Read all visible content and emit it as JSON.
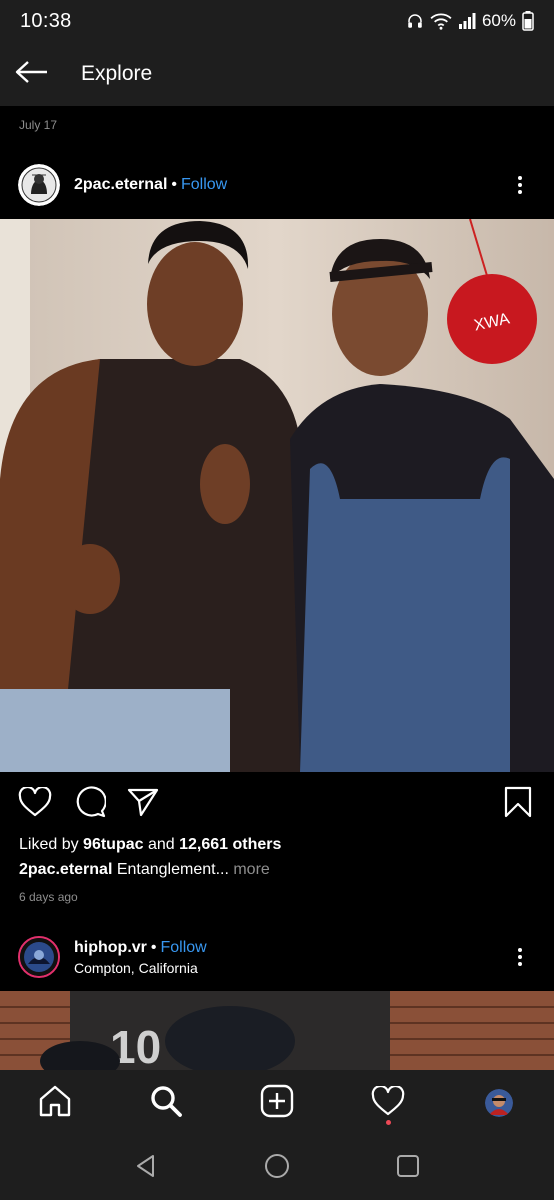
{
  "status_bar": {
    "time": "10:38",
    "battery": "60%",
    "icons": [
      "headphones-icon",
      "wifi-icon",
      "signal-icon",
      "battery-icon"
    ]
  },
  "header": {
    "title": "Explore",
    "back_icon": "arrow-left-icon"
  },
  "previous_post": {
    "date": "July 17"
  },
  "post": {
    "username": "2pac.eternal",
    "separator": "•",
    "follow_label": "Follow",
    "likes_prefix": "Liked by ",
    "likes_user": "96tupac",
    "likes_middle": " and ",
    "likes_count": "12,661 others",
    "caption_user": "2pac.eternal",
    "caption_text": " Entanglement...",
    "caption_more": " more",
    "date": "6 days ago",
    "image_text": "XWA"
  },
  "next_post": {
    "username": "hiphop.vr",
    "separator": "•",
    "follow_label": "Follow",
    "location": "Compton, California",
    "image_text": "10"
  },
  "bottom_nav": {
    "items": [
      "home-icon",
      "search-icon",
      "add-post-icon",
      "heart-icon",
      "profile-avatar"
    ]
  },
  "system_nav": {
    "items": [
      "back-triangle-icon",
      "home-circle-icon",
      "recents-square-icon"
    ]
  },
  "colors": {
    "accent": "#3897f0",
    "bar_background": "#1e1e1e",
    "muted_text": "#8e8e8e",
    "notification": "#ed4956"
  }
}
